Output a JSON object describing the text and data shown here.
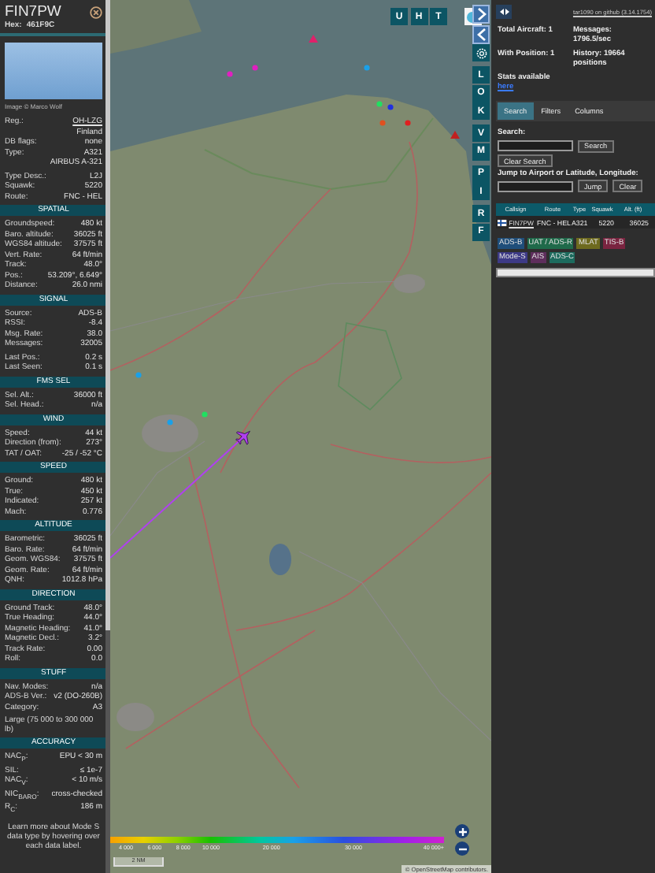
{
  "aircraft": {
    "callsign": "FIN7PW",
    "hex_label": "Hex:",
    "hex": "461F9C",
    "photo_credit": "Image © Marco Wolf"
  },
  "detail_groups": [
    [
      {
        "label": "Reg.:",
        "value": "OH-LZG",
        "link": true
      },
      {
        "value": "Finland"
      },
      {
        "label": "DB flags:",
        "value": "none"
      },
      {
        "label": "Type:",
        "value": "A321"
      },
      {
        "value": "AIRBUS A-321"
      }
    ],
    [
      {
        "label": "Type Desc.:",
        "value": "L2J"
      },
      {
        "label": "Squawk:",
        "value": "5220"
      },
      {
        "label": "Route:",
        "value": "FNC - HEL"
      }
    ]
  ],
  "sections": [
    {
      "title": "SPATIAL",
      "groups": [
        [
          {
            "label": "Groundspeed:",
            "value": "480 kt"
          },
          {
            "label": "Baro. altitude:",
            "value": "36025 ft"
          },
          {
            "label": "WGS84 altitude:",
            "value": "37575 ft"
          },
          {
            "label": "Vert. Rate:",
            "value": "64 ft/min"
          },
          {
            "label": "Track:",
            "value": "48.0°"
          },
          {
            "label": "Pos.:",
            "value": "53.209°, 6.649°"
          },
          {
            "label": "Distance:",
            "value": "26.0 nmi"
          }
        ]
      ]
    },
    {
      "title": "SIGNAL",
      "groups": [
        [
          {
            "label": "Source:",
            "value": "ADS-B"
          },
          {
            "label": "RSSI:",
            "value": "-8.4"
          },
          {
            "label": "Msg. Rate:",
            "value": "38.0"
          },
          {
            "label": "Messages:",
            "value": "32005"
          }
        ],
        [
          {
            "label": "Last Pos.:",
            "value": "0.2 s"
          },
          {
            "label": "Last Seen:",
            "value": "0.1 s"
          }
        ]
      ]
    },
    {
      "title": "FMS SEL",
      "groups": [
        [
          {
            "label": "Sel. Alt.:",
            "value": "36000 ft"
          },
          {
            "label": "Sel. Head.:",
            "value": "n/a"
          }
        ]
      ]
    },
    {
      "title": "WIND",
      "groups": [
        [
          {
            "label": "Speed:",
            "value": "44 kt"
          },
          {
            "label": "Direction (from):",
            "value": "273°"
          },
          {
            "label": "TAT / OAT:",
            "value": "-25 / -52 °C"
          }
        ]
      ]
    },
    {
      "title": "SPEED",
      "groups": [
        [
          {
            "label": "Ground:",
            "value": "480 kt"
          },
          {
            "label": "True:",
            "value": "450 kt"
          },
          {
            "label": "Indicated:",
            "value": "257 kt"
          },
          {
            "label": "Mach:",
            "value": "0.776"
          }
        ]
      ]
    },
    {
      "title": "ALTITUDE",
      "groups": [
        [
          {
            "label": "Barometric:",
            "value": "36025 ft"
          },
          {
            "label": "Baro. Rate:",
            "value": "64 ft/min"
          },
          {
            "label": "Geom. WGS84:",
            "value": "37575 ft"
          },
          {
            "label": "Geom. Rate:",
            "value": "64 ft/min"
          },
          {
            "label": "QNH:",
            "value": "1012.8 hPa"
          }
        ]
      ]
    },
    {
      "title": "DIRECTION",
      "groups": [
        [
          {
            "label": "Ground Track:",
            "value": "48.0°"
          },
          {
            "label": "True Heading:",
            "value": "44.0°"
          },
          {
            "label": "Magnetic Heading:",
            "value": "41.0°"
          },
          {
            "label": "Magnetic Decl.:",
            "value": "3.2°"
          },
          {
            "label": "Track Rate:",
            "value": "0.00"
          },
          {
            "label": "Roll:",
            "value": "0.0"
          }
        ]
      ]
    },
    {
      "title": "STUFF",
      "groups": [
        [
          {
            "label": "Nav. Modes:",
            "value": "n/a"
          },
          {
            "label": "ADS-B Ver.:",
            "value": "v2 (DO-260B)"
          },
          {
            "label": "Category:",
            "value": "A3"
          }
        ]
      ],
      "note": "Large (75 000 to 300 000 lb)"
    },
    {
      "title": "ACCURACY",
      "groups": [
        [
          {
            "label": "NAC$_{P}$:",
            "value": "EPU < 30 m"
          },
          {
            "label": "SIL:",
            "value": "≤ 1e-7"
          },
          {
            "label": "NAC$_{V}$:",
            "value": "< 10 m/s"
          },
          {
            "label": "NIC$_{BARO}$:",
            "value": "cross-checked"
          },
          {
            "label": "R$_{C}$:",
            "value": "186 m"
          }
        ]
      ]
    }
  ],
  "footer_note": "Learn more about Mode S data type by hovering over each data label.",
  "map": {
    "top_buttons": [
      "U",
      "H",
      "T"
    ],
    "side_buttons": [
      [
        "L",
        "O",
        "K"
      ],
      [
        "V",
        "M"
      ],
      [
        "P",
        "I"
      ],
      [
        "R",
        "F"
      ]
    ],
    "legend_ticks": [
      "4 000",
      "6 000",
      "8 000",
      "10 000",
      "20 000",
      "30 000",
      "40 000+"
    ],
    "scale": "2 NM",
    "attribution": "© OpenStreetMap contributors."
  },
  "header": {
    "version_link": "tar1090 on github (3.14.1754)"
  },
  "stats": {
    "total": "Total Aircraft: 1",
    "messages": "Messages: 1796.5/sec",
    "with_position": "With Position: 1",
    "history": "History: 19664 positions",
    "stats_text": "Stats available",
    "stats_link": "here"
  },
  "tabs": [
    {
      "label": "Search",
      "selected": true
    },
    {
      "label": "Filters",
      "selected": false
    },
    {
      "label": "Columns",
      "selected": false
    }
  ],
  "search": {
    "label": "Search:",
    "button": "Search",
    "clear_button": "Clear Search",
    "jump_label": "Jump to Airport or Latitude, Longitude:",
    "jump_button": "Jump",
    "jump_clear": "Clear"
  },
  "table": {
    "columns": [
      "Callsign",
      "Route",
      "Type",
      "Squawk",
      "Alt. (ft)"
    ],
    "rows": [
      {
        "callsign": "FIN7PW",
        "route": "FNC - HEL",
        "type": "A321",
        "squawk": "5220",
        "altitude": "36025"
      }
    ]
  },
  "legend": {
    "badges": [
      {
        "label": "ADS-B",
        "color": "#1f4e7a"
      },
      {
        "label": "UAT / ADS-R",
        "color": "#1f6a4a"
      },
      {
        "label": "MLAT",
        "color": "#6e6a1e"
      },
      {
        "label": "TIS-B",
        "color": "#7a2440"
      },
      {
        "label": "Mode-S",
        "color": "#3d3a86"
      },
      {
        "label": "AIS",
        "color": "#5e2e5c"
      },
      {
        "label": "ADS-C",
        "color": "#1d6b5e"
      }
    ]
  }
}
